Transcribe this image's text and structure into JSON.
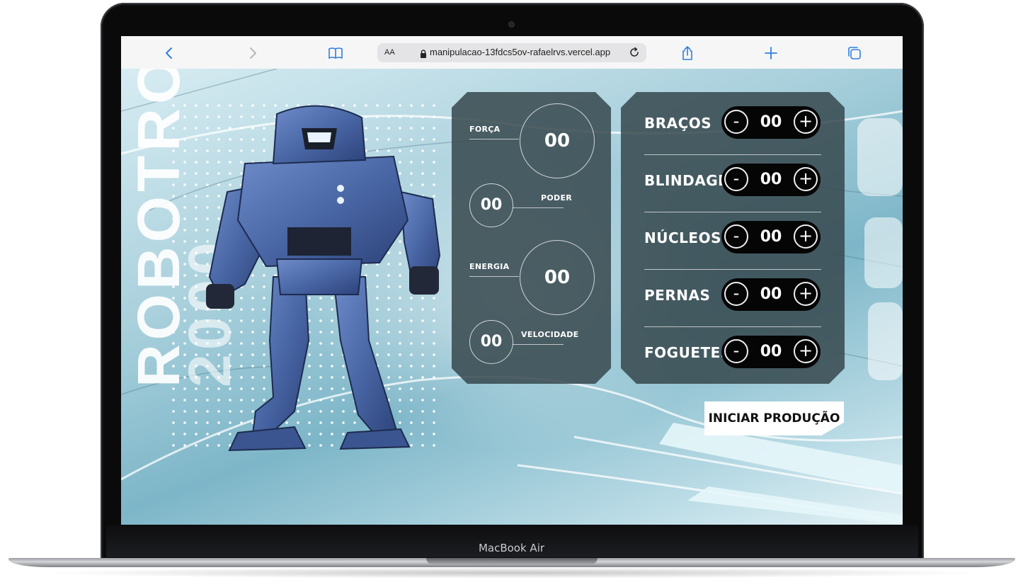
{
  "device": {
    "model_label": "MacBook Air"
  },
  "browser": {
    "text_size_label": "AA",
    "url": "manipulacao-13fdcs5ov-rafaelrvs.vercel.app",
    "icons": [
      "back-icon",
      "forward-icon",
      "bookmarks-icon",
      "lock-icon",
      "reload-icon",
      "share-icon",
      "new-tab-icon",
      "tabs-icon"
    ]
  },
  "brand": {
    "line1": "ROBOTRON",
    "line2": "2000"
  },
  "stats": [
    {
      "label": "FORÇA",
      "value": "00"
    },
    {
      "label": "PODER",
      "value": "00"
    },
    {
      "label": "ENERGIA",
      "value": "00"
    },
    {
      "label": "VELOCIDADE",
      "value": "00"
    }
  ],
  "controls": [
    {
      "label": "BRAÇOS",
      "value": "00",
      "minus": "-",
      "plus": "+"
    },
    {
      "label": "BLINDAGEM",
      "value": "00",
      "minus": "-",
      "plus": "+"
    },
    {
      "label": "NÚCLEOS",
      "value": "00",
      "minus": "-",
      "plus": "+"
    },
    {
      "label": "PERNAS",
      "value": "00",
      "minus": "-",
      "plus": "+"
    },
    {
      "label": "FOGUETES",
      "value": "00",
      "minus": "-",
      "plus": "+"
    }
  ],
  "start_button": {
    "label": "INICIAR PRODUÇÃO"
  },
  "colors": {
    "accent": "#2f7fe0",
    "panel": "#37484e",
    "stepper": "#050505",
    "robot": "#4a67a6"
  }
}
